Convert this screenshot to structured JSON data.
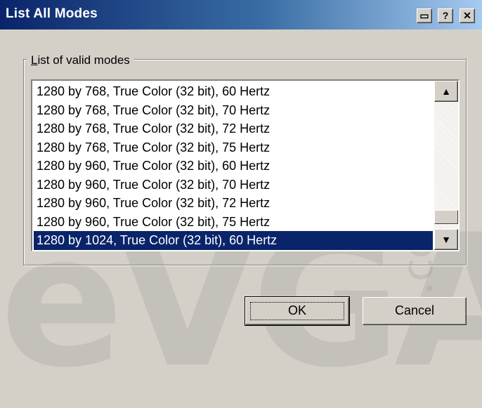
{
  "window": {
    "title": "List All Modes",
    "buttons": {
      "restore": "▭",
      "help": "?",
      "close": "✕"
    }
  },
  "group": {
    "label_prefix": "L",
    "label_rest": "ist of valid modes"
  },
  "modes": [
    "1280 by 768, True Color (32 bit), 60 Hertz",
    "1280 by 768, True Color (32 bit), 70 Hertz",
    "1280 by 768, True Color (32 bit), 72 Hertz",
    "1280 by 768, True Color (32 bit), 75 Hertz",
    "1280 by 960, True Color (32 bit), 60 Hertz",
    "1280 by 960, True Color (32 bit), 70 Hertz",
    "1280 by 960, True Color (32 bit), 72 Hertz",
    "1280 by 960, True Color (32 bit), 75 Hertz",
    "1280 by 1024, True Color (32 bit), 60 Hertz"
  ],
  "selected_index": 8,
  "scroll": {
    "up": "▲",
    "down": "▼"
  },
  "actions": {
    "ok": "OK",
    "cancel": "Cancel"
  },
  "watermark": {
    "text": "eVGA",
    "suffix": ".com"
  },
  "colors": {
    "selection": "#0a246a",
    "title_start": "#0a246a",
    "title_end": "#a6caf0",
    "face": "#d4d0c8"
  }
}
